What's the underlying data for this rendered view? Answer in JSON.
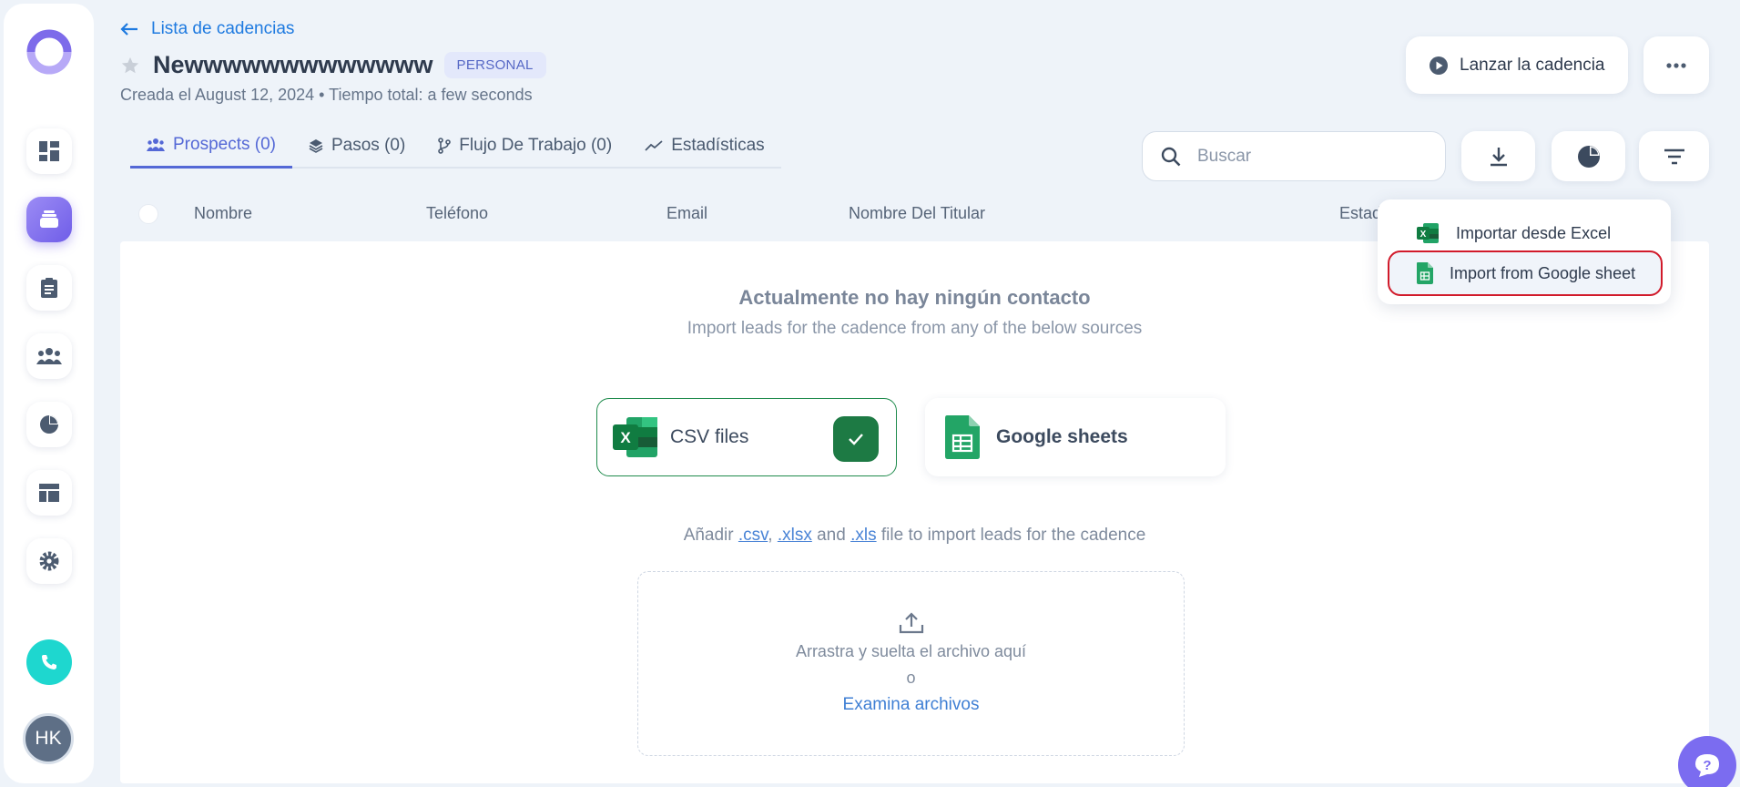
{
  "nav": {
    "back_label": "Lista de cadencias",
    "user_initials": "HK"
  },
  "cadence": {
    "title": "Newwwwwwwwwwwww",
    "badge": "PERSONAL",
    "subtitle": "Creada el August 12, 2024 • Tiempo total: a few seconds"
  },
  "actions": {
    "launch_label": "Lanzar la cadencia"
  },
  "tabs": [
    {
      "label": "Prospects (0)",
      "icon": "users-icon"
    },
    {
      "label": "Pasos (0)",
      "icon": "layers-icon"
    },
    {
      "label": "Flujo De Trabajo (0)",
      "icon": "workflow-icon"
    },
    {
      "label": "Estadísticas",
      "icon": "trend-icon"
    }
  ],
  "search": {
    "placeholder": "Buscar"
  },
  "table": {
    "columns": [
      "Nombre",
      "Teléfono",
      "Email",
      "Nombre Del Titular",
      "Estad"
    ]
  },
  "empty": {
    "title": "Actualmente no hay ningún contacto",
    "subtitle": "Import leads for the cadence from any of the below sources"
  },
  "sources": {
    "csv_label": "CSV files",
    "gsheets_label": "Google sheets"
  },
  "hint": {
    "prefix": "Añadir",
    "ext_csv": ".csv",
    "sep": ",",
    "ext_xlsx": ".xlsx",
    "and": "and",
    "ext_xls": ".xls",
    "suffix": "file to import leads for the cadence"
  },
  "dropzone": {
    "text": "Arrastra y suelta el archivo aquí",
    "or": "o",
    "browse": "Examina archivos"
  },
  "import_menu": {
    "items": [
      "Importar desde Excel",
      "Import from Google sheet"
    ]
  },
  "colors": {
    "accent": "#5468d6",
    "link": "#1e7ae0",
    "excel_green": "#1d7a44",
    "sheets_green": "#23a566",
    "highlight_red": "#d11a2a"
  }
}
